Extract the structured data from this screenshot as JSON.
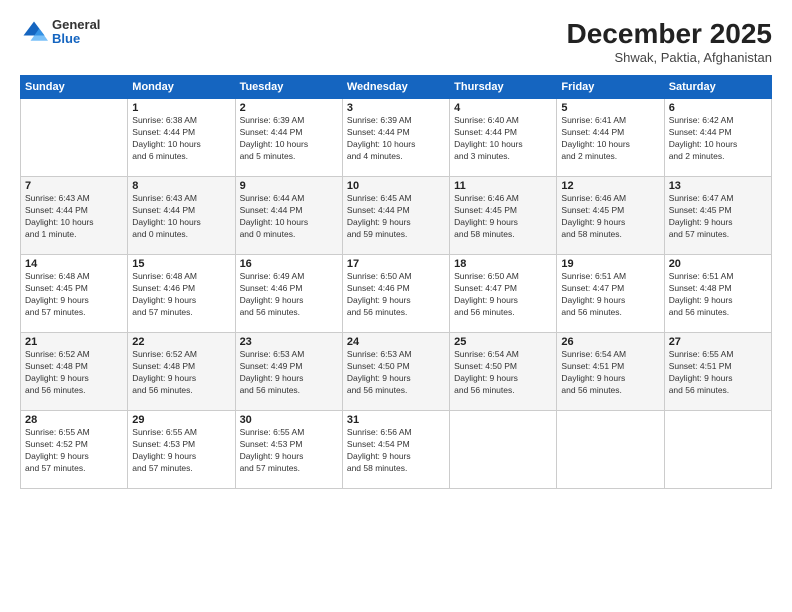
{
  "header": {
    "logo_general": "General",
    "logo_blue": "Blue",
    "month_title": "December 2025",
    "location": "Shwak, Paktia, Afghanistan"
  },
  "calendar": {
    "days_of_week": [
      "Sunday",
      "Monday",
      "Tuesday",
      "Wednesday",
      "Thursday",
      "Friday",
      "Saturday"
    ],
    "weeks": [
      [
        {
          "num": "",
          "info": ""
        },
        {
          "num": "1",
          "info": "Sunrise: 6:38 AM\nSunset: 4:44 PM\nDaylight: 10 hours\nand 6 minutes."
        },
        {
          "num": "2",
          "info": "Sunrise: 6:39 AM\nSunset: 4:44 PM\nDaylight: 10 hours\nand 5 minutes."
        },
        {
          "num": "3",
          "info": "Sunrise: 6:39 AM\nSunset: 4:44 PM\nDaylight: 10 hours\nand 4 minutes."
        },
        {
          "num": "4",
          "info": "Sunrise: 6:40 AM\nSunset: 4:44 PM\nDaylight: 10 hours\nand 3 minutes."
        },
        {
          "num": "5",
          "info": "Sunrise: 6:41 AM\nSunset: 4:44 PM\nDaylight: 10 hours\nand 2 minutes."
        },
        {
          "num": "6",
          "info": "Sunrise: 6:42 AM\nSunset: 4:44 PM\nDaylight: 10 hours\nand 2 minutes."
        }
      ],
      [
        {
          "num": "7",
          "info": "Sunrise: 6:43 AM\nSunset: 4:44 PM\nDaylight: 10 hours\nand 1 minute."
        },
        {
          "num": "8",
          "info": "Sunrise: 6:43 AM\nSunset: 4:44 PM\nDaylight: 10 hours\nand 0 minutes."
        },
        {
          "num": "9",
          "info": "Sunrise: 6:44 AM\nSunset: 4:44 PM\nDaylight: 10 hours\nand 0 minutes."
        },
        {
          "num": "10",
          "info": "Sunrise: 6:45 AM\nSunset: 4:44 PM\nDaylight: 9 hours\nand 59 minutes."
        },
        {
          "num": "11",
          "info": "Sunrise: 6:46 AM\nSunset: 4:45 PM\nDaylight: 9 hours\nand 58 minutes."
        },
        {
          "num": "12",
          "info": "Sunrise: 6:46 AM\nSunset: 4:45 PM\nDaylight: 9 hours\nand 58 minutes."
        },
        {
          "num": "13",
          "info": "Sunrise: 6:47 AM\nSunset: 4:45 PM\nDaylight: 9 hours\nand 57 minutes."
        }
      ],
      [
        {
          "num": "14",
          "info": "Sunrise: 6:48 AM\nSunset: 4:45 PM\nDaylight: 9 hours\nand 57 minutes."
        },
        {
          "num": "15",
          "info": "Sunrise: 6:48 AM\nSunset: 4:46 PM\nDaylight: 9 hours\nand 57 minutes."
        },
        {
          "num": "16",
          "info": "Sunrise: 6:49 AM\nSunset: 4:46 PM\nDaylight: 9 hours\nand 56 minutes."
        },
        {
          "num": "17",
          "info": "Sunrise: 6:50 AM\nSunset: 4:46 PM\nDaylight: 9 hours\nand 56 minutes."
        },
        {
          "num": "18",
          "info": "Sunrise: 6:50 AM\nSunset: 4:47 PM\nDaylight: 9 hours\nand 56 minutes."
        },
        {
          "num": "19",
          "info": "Sunrise: 6:51 AM\nSunset: 4:47 PM\nDaylight: 9 hours\nand 56 minutes."
        },
        {
          "num": "20",
          "info": "Sunrise: 6:51 AM\nSunset: 4:48 PM\nDaylight: 9 hours\nand 56 minutes."
        }
      ],
      [
        {
          "num": "21",
          "info": "Sunrise: 6:52 AM\nSunset: 4:48 PM\nDaylight: 9 hours\nand 56 minutes."
        },
        {
          "num": "22",
          "info": "Sunrise: 6:52 AM\nSunset: 4:48 PM\nDaylight: 9 hours\nand 56 minutes."
        },
        {
          "num": "23",
          "info": "Sunrise: 6:53 AM\nSunset: 4:49 PM\nDaylight: 9 hours\nand 56 minutes."
        },
        {
          "num": "24",
          "info": "Sunrise: 6:53 AM\nSunset: 4:50 PM\nDaylight: 9 hours\nand 56 minutes."
        },
        {
          "num": "25",
          "info": "Sunrise: 6:54 AM\nSunset: 4:50 PM\nDaylight: 9 hours\nand 56 minutes."
        },
        {
          "num": "26",
          "info": "Sunrise: 6:54 AM\nSunset: 4:51 PM\nDaylight: 9 hours\nand 56 minutes."
        },
        {
          "num": "27",
          "info": "Sunrise: 6:55 AM\nSunset: 4:51 PM\nDaylight: 9 hours\nand 56 minutes."
        }
      ],
      [
        {
          "num": "28",
          "info": "Sunrise: 6:55 AM\nSunset: 4:52 PM\nDaylight: 9 hours\nand 57 minutes."
        },
        {
          "num": "29",
          "info": "Sunrise: 6:55 AM\nSunset: 4:53 PM\nDaylight: 9 hours\nand 57 minutes."
        },
        {
          "num": "30",
          "info": "Sunrise: 6:55 AM\nSunset: 4:53 PM\nDaylight: 9 hours\nand 57 minutes."
        },
        {
          "num": "31",
          "info": "Sunrise: 6:56 AM\nSunset: 4:54 PM\nDaylight: 9 hours\nand 58 minutes."
        },
        {
          "num": "",
          "info": ""
        },
        {
          "num": "",
          "info": ""
        },
        {
          "num": "",
          "info": ""
        }
      ]
    ]
  }
}
